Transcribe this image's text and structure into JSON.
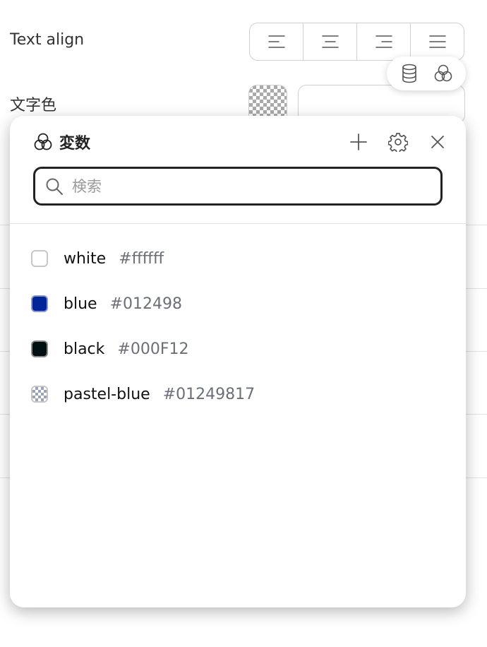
{
  "panel": {
    "text_align_label": "Text align",
    "text_color_label": "文字色",
    "align_options": [
      {
        "name": "align-left",
        "icon": "align-left-icon"
      },
      {
        "name": "align-center",
        "icon": "align-center-icon"
      },
      {
        "name": "align-right",
        "icon": "align-right-icon"
      },
      {
        "name": "align-justify",
        "icon": "align-justify-icon"
      }
    ],
    "mini_toolbar_icons": [
      "database-icon",
      "variables-icon"
    ]
  },
  "popover": {
    "title": "変数",
    "title_icon": "variables-icon",
    "actions": [
      "add-icon",
      "gear-icon",
      "close-icon"
    ],
    "search": {
      "placeholder": "検索",
      "value": ""
    },
    "variables": [
      {
        "name": "white",
        "value": "#ffffff",
        "swatch_color": "#ffffff",
        "border_color": "#c7c7c7",
        "checker": false
      },
      {
        "name": "blue",
        "value": "#012498",
        "swatch_color": "#012498",
        "border_color": "#8a97c8",
        "checker": false
      },
      {
        "name": "black",
        "value": "#000F12",
        "swatch_color": "#000F12",
        "border_color": "#8c8c8c",
        "checker": false
      },
      {
        "name": "pastel-blue",
        "value": "#01249817",
        "swatch_color": "#01249817",
        "border_color": "#c7c7c7",
        "checker": true
      }
    ]
  },
  "colors": {
    "text_primary": "#222222",
    "text_muted": "#6b6f78",
    "border": "#cfcfcf"
  }
}
